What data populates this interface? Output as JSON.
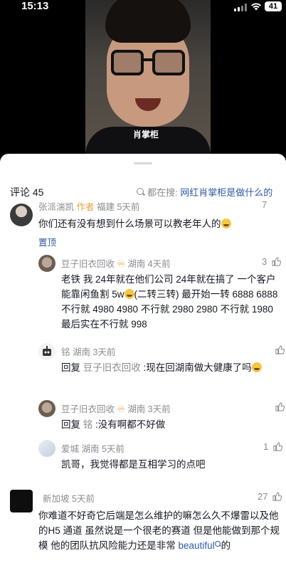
{
  "status_bar": {
    "time": "15:13",
    "battery": "41"
  },
  "video": {
    "caption": "肖掌柜"
  },
  "sheet": {
    "comment_count_label": "评论 45",
    "search_prefix": "都在搜:",
    "search_query": "网红肖掌柜是做什么的"
  },
  "comments": [
    {
      "author": "张派湍凯",
      "author_tag": "作者",
      "location_time": "福建 5天前",
      "like_count": "7",
      "text": "你们还有没有想到什么场景可以教老年人的",
      "pinned_label": "置顶"
    },
    {
      "author": "豆子旧衣回收",
      "location_time": "湖南 4天前",
      "like_count": "3",
      "text": "老铁 我 24年就在他们公司 24年就在搞了 一个客户能靠闲鱼割 5w",
      "text_suffix": "(二转三转) 最开始一转 6888 6888 不行就 4980 4980 不行就 2980 2980 不行就 1980 最后实在不行就 998"
    },
    {
      "author": "铭",
      "location_time": "湖南 3天前",
      "reply_label": "回复",
      "reply_to": "豆子旧衣回收",
      "text": ":现在回湖南做大健康了吗"
    },
    {
      "author": "豆子旧衣回收",
      "location_time": "湖南 3天前",
      "reply_label": "回复",
      "reply_to": "铭",
      "text": ":没有啊都不好做"
    },
    {
      "author": "爱城",
      "location_time": "湖南 5天前",
      "like_count": "1",
      "text": "凯哥，我觉得都是互相学习的点吧"
    },
    {
      "author": "新加坡",
      "location_time": "5天前",
      "like_count": "27",
      "text": "你难道不好奇它后端是怎么维护的嘛怎么久不爆雷以及他的H5 通道 虽然说是一个很老的赛道 但是他能做到那个规模 他的团队抗风险能力还是非常",
      "link_text": "beautiful",
      "text_end": "的"
    }
  ]
}
